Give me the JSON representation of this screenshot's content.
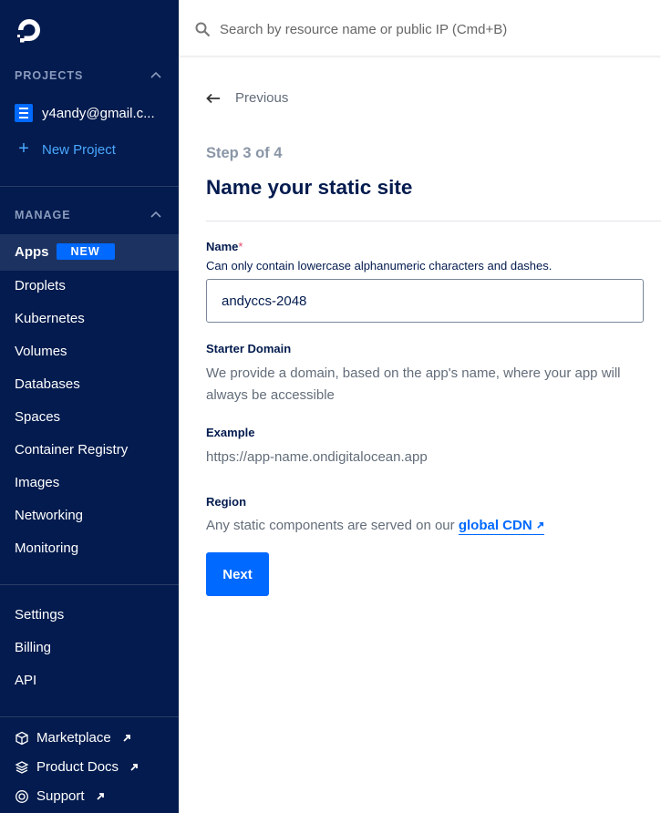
{
  "sidebar": {
    "projects_heading": "PROJECTS",
    "project_name": "y4andy@gmail.c...",
    "new_project": "New Project",
    "manage_heading": "MANAGE",
    "apps": "Apps",
    "apps_badge": "NEW",
    "items": [
      "Droplets",
      "Kubernetes",
      "Volumes",
      "Databases",
      "Spaces",
      "Container Registry",
      "Images",
      "Networking",
      "Monitoring"
    ],
    "settings": [
      "Settings",
      "Billing",
      "API"
    ],
    "external": [
      "Marketplace",
      "Product Docs",
      "Support"
    ]
  },
  "search": {
    "placeholder": "Search by resource name or public IP (Cmd+B)"
  },
  "main": {
    "previous": "Previous",
    "step": "Step 3 of 4",
    "title": "Name your static site",
    "name_label": "Name",
    "required_mark": "*",
    "name_hint": "Can only contain lowercase alphanumeric characters and dashes.",
    "name_value": "andyccs-2048",
    "starter_domain_label": "Starter Domain",
    "starter_domain_desc": "We provide a domain, based on the app's name, where your app will always be accessible",
    "example_label": "Example",
    "example_value": "https://app-name.ondigitalocean.app",
    "region_label": "Region",
    "region_desc": "Any static components are served on our",
    "cdn_link": "global CDN",
    "next_button": "Next"
  },
  "colors": {
    "sidebar_bg": "#031b4e",
    "accent": "#0069ff",
    "active_bg": "#1c3362"
  }
}
